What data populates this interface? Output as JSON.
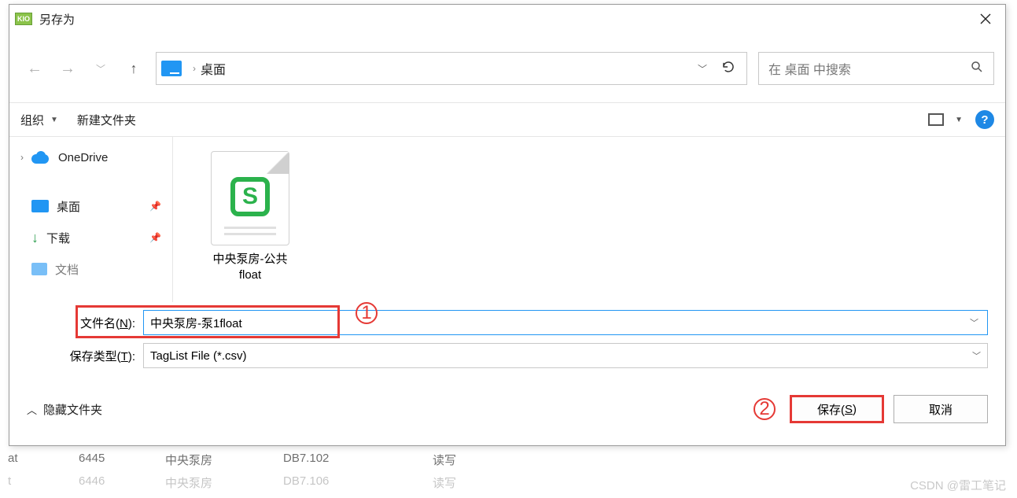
{
  "window": {
    "title": "另存为"
  },
  "nav": {
    "location": "桌面",
    "refresh_icon": "↻"
  },
  "search": {
    "placeholder": "在 桌面 中搜索"
  },
  "toolbar": {
    "organize": "组织",
    "newfolder": "新建文件夹"
  },
  "sidebar": {
    "onedrive": "OneDrive",
    "desktop": "桌面",
    "downloads": "下载",
    "documents": "文档"
  },
  "content": {
    "file1_line1": "中央泵房-公共",
    "file1_line2": "float"
  },
  "form": {
    "filename_label_pre": "文件名(",
    "filename_label_key": "N",
    "filename_label_post": "):",
    "filename_value": "中央泵房-泵1float",
    "filetype_label_pre": "保存类型(",
    "filetype_label_key": "T",
    "filetype_label_post": "):",
    "filetype_value": "TagList File (*.csv)"
  },
  "footer": {
    "hide_folders": "隐藏文件夹",
    "save_pre": "保存(",
    "save_key": "S",
    "save_post": ")",
    "cancel": "取消"
  },
  "annotations": {
    "one": "1",
    "two": "2"
  },
  "background_rows": [
    {
      "c2": "6445",
      "c3": "中央泵房",
      "c4": "DB7.102",
      "c5": "读写"
    },
    {
      "c2": "6446",
      "c3": "中央泵房",
      "c4": "DB7.106",
      "c5": "读写"
    }
  ],
  "watermark": "CSDN @雷工笔记"
}
